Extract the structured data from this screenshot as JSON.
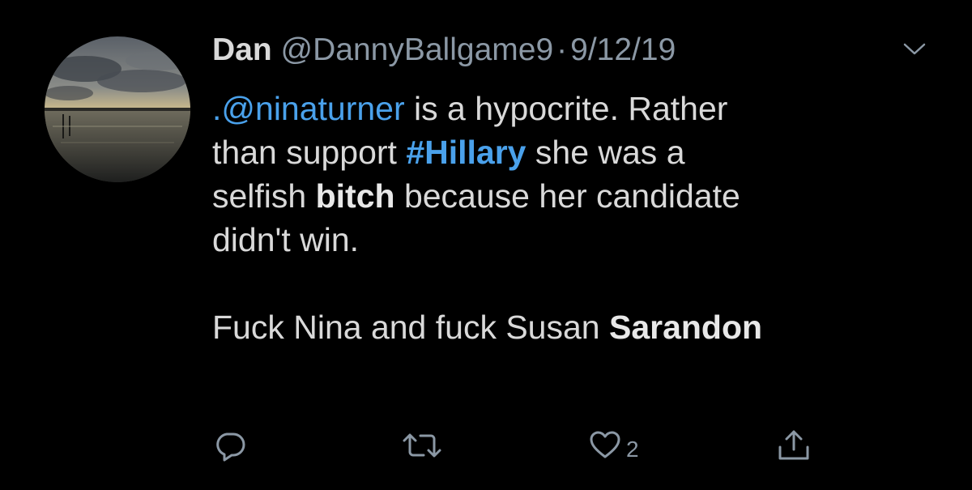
{
  "tweet": {
    "author_name": "Dan",
    "handle": "@DannyBallgame9",
    "separator": "·",
    "date": "9/12/19",
    "body": {
      "mention": ".@ninaturner",
      "line1_rest": " is a hypocrite. Rather",
      "line2_start": "than support ",
      "hashtag": "#Hillary",
      "line2_rest": " she was a",
      "line3_start": "selfish ",
      "bold_word": "bitch",
      "line3_rest": " because her candidate",
      "line4": "didn't win.",
      "line5_start": "Fuck Nina and fuck Susan ",
      "bold_word2": "Sarandon"
    },
    "actions": {
      "reply_icon": "reply-icon",
      "retweet_icon": "retweet-icon",
      "like_icon": "heart-icon",
      "like_count": "2",
      "share_icon": "share-icon"
    }
  },
  "colors": {
    "background": "#000000",
    "text": "#d9d9d9",
    "secondary": "#8b98a5",
    "link": "#4aa1eb"
  }
}
